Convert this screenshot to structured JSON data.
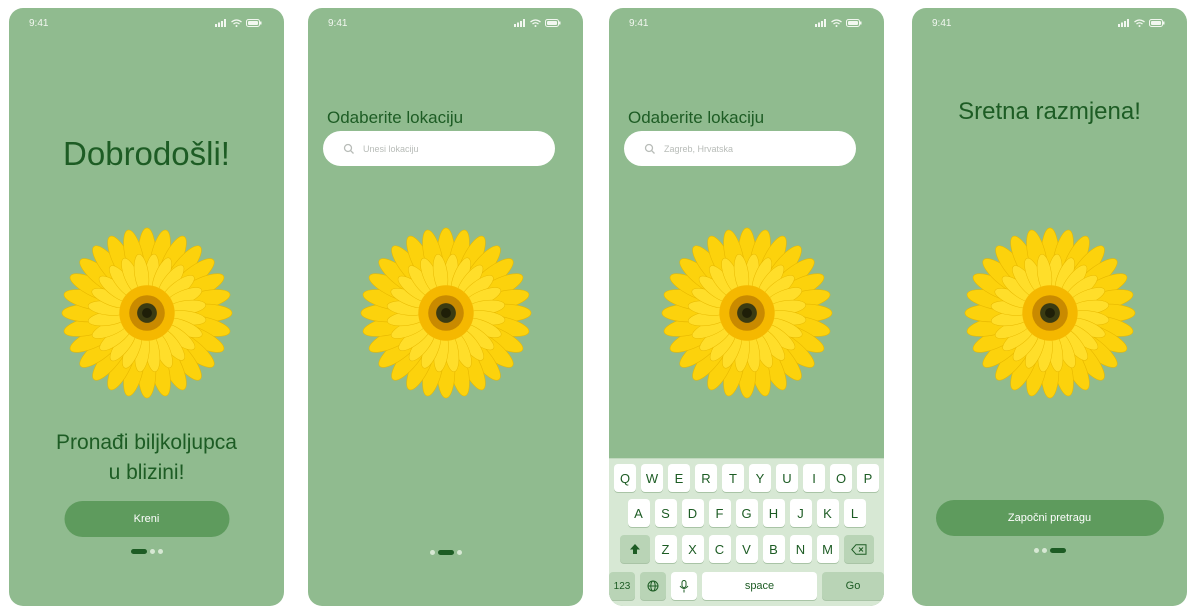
{
  "status": {
    "time": "9:41"
  },
  "screen1": {
    "title": "Dobrodošli!",
    "tagline_line1": "Pronađi biljkoljupca",
    "tagline_line2": "u blizini!",
    "button": "Kreni"
  },
  "screen2": {
    "label": "Odaberite lokaciju",
    "search_placeholder": "Unesi lokaciju"
  },
  "screen3": {
    "label": "Odaberite lokaciju",
    "search_value": "Zagreb, Hrvatska",
    "keyboard": {
      "row1": [
        "Q",
        "W",
        "E",
        "R",
        "T",
        "Y",
        "U",
        "I",
        "O",
        "P"
      ],
      "row2": [
        "A",
        "S",
        "D",
        "F",
        "G",
        "H",
        "J",
        "K",
        "L"
      ],
      "row3": [
        "Z",
        "X",
        "C",
        "V",
        "B",
        "N",
        "M"
      ],
      "numbers_key": "123",
      "space_key": "space",
      "go_key": "Go"
    }
  },
  "screen4": {
    "title": "Sretna razmjena!",
    "button": "Započni pretragu"
  },
  "pagination": {
    "screen1_active": 1,
    "screen2_active": 2,
    "screen4_active": 3,
    "total": 3
  },
  "colors": {
    "background": "#90bb8f",
    "title": "#1d5c24",
    "button": "#5e9b5d",
    "petal": "#fcd20c",
    "center": "#3b3b12"
  }
}
